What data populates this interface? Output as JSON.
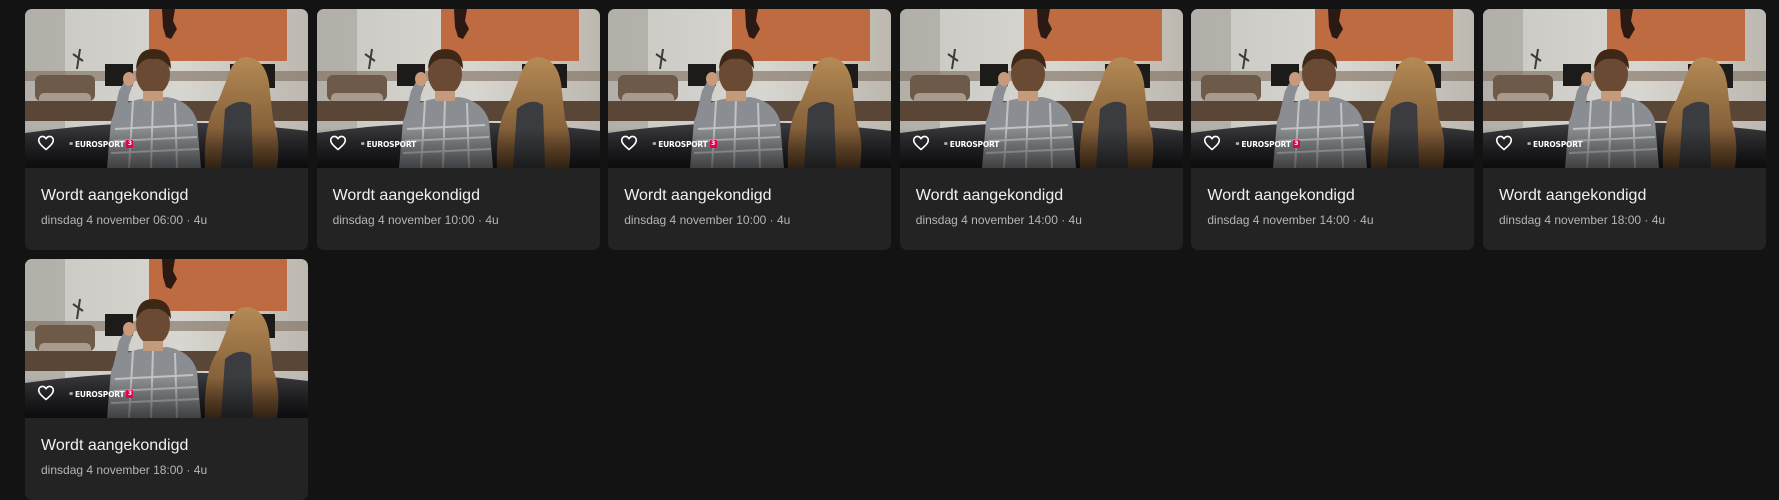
{
  "cards": [
    {
      "title": "Wordt aangekondigd",
      "subtitle": "dinsdag 4 november 06:00 · 4u",
      "channel": {
        "prefix": "≡",
        "name": "EUROSPORT",
        "number": "3"
      },
      "favorite_icon": "heart-outline-icon"
    },
    {
      "title": "Wordt aangekondigd",
      "subtitle": "dinsdag 4 november 10:00 · 4u",
      "channel": {
        "prefix": "≡",
        "name": "EUROSPORT",
        "number": ""
      },
      "favorite_icon": "heart-outline-icon"
    },
    {
      "title": "Wordt aangekondigd",
      "subtitle": "dinsdag 4 november 10:00 · 4u",
      "channel": {
        "prefix": "≡",
        "name": "EUROSPORT",
        "number": "3"
      },
      "favorite_icon": "heart-outline-icon"
    },
    {
      "title": "Wordt aangekondigd",
      "subtitle": "dinsdag 4 november 14:00 · 4u",
      "channel": {
        "prefix": "≡",
        "name": "EUROSPORT",
        "number": ""
      },
      "favorite_icon": "heart-outline-icon"
    },
    {
      "title": "Wordt aangekondigd",
      "subtitle": "dinsdag 4 november 14:00 · 4u",
      "channel": {
        "prefix": "≡",
        "name": "EUROSPORT",
        "number": "3"
      },
      "favorite_icon": "heart-outline-icon"
    },
    {
      "title": "Wordt aangekondigd",
      "subtitle": "dinsdag 4 november 18:00 · 4u",
      "channel": {
        "prefix": "≡",
        "name": "EUROSPORT",
        "number": ""
      },
      "favorite_icon": "heart-outline-icon"
    },
    {
      "title": "Wordt aangekondigd",
      "subtitle": "dinsdag 4 november 18:00 · 4u",
      "channel": {
        "prefix": "≡",
        "name": "EUROSPORT",
        "number": "3"
      },
      "favorite_icon": "heart-outline-icon"
    }
  ],
  "colors": {
    "background": "#131313",
    "card": "#232323",
    "title": "#f1f1f1",
    "subtitle": "#b5b5b5",
    "channel_badge": "#e5004d"
  }
}
